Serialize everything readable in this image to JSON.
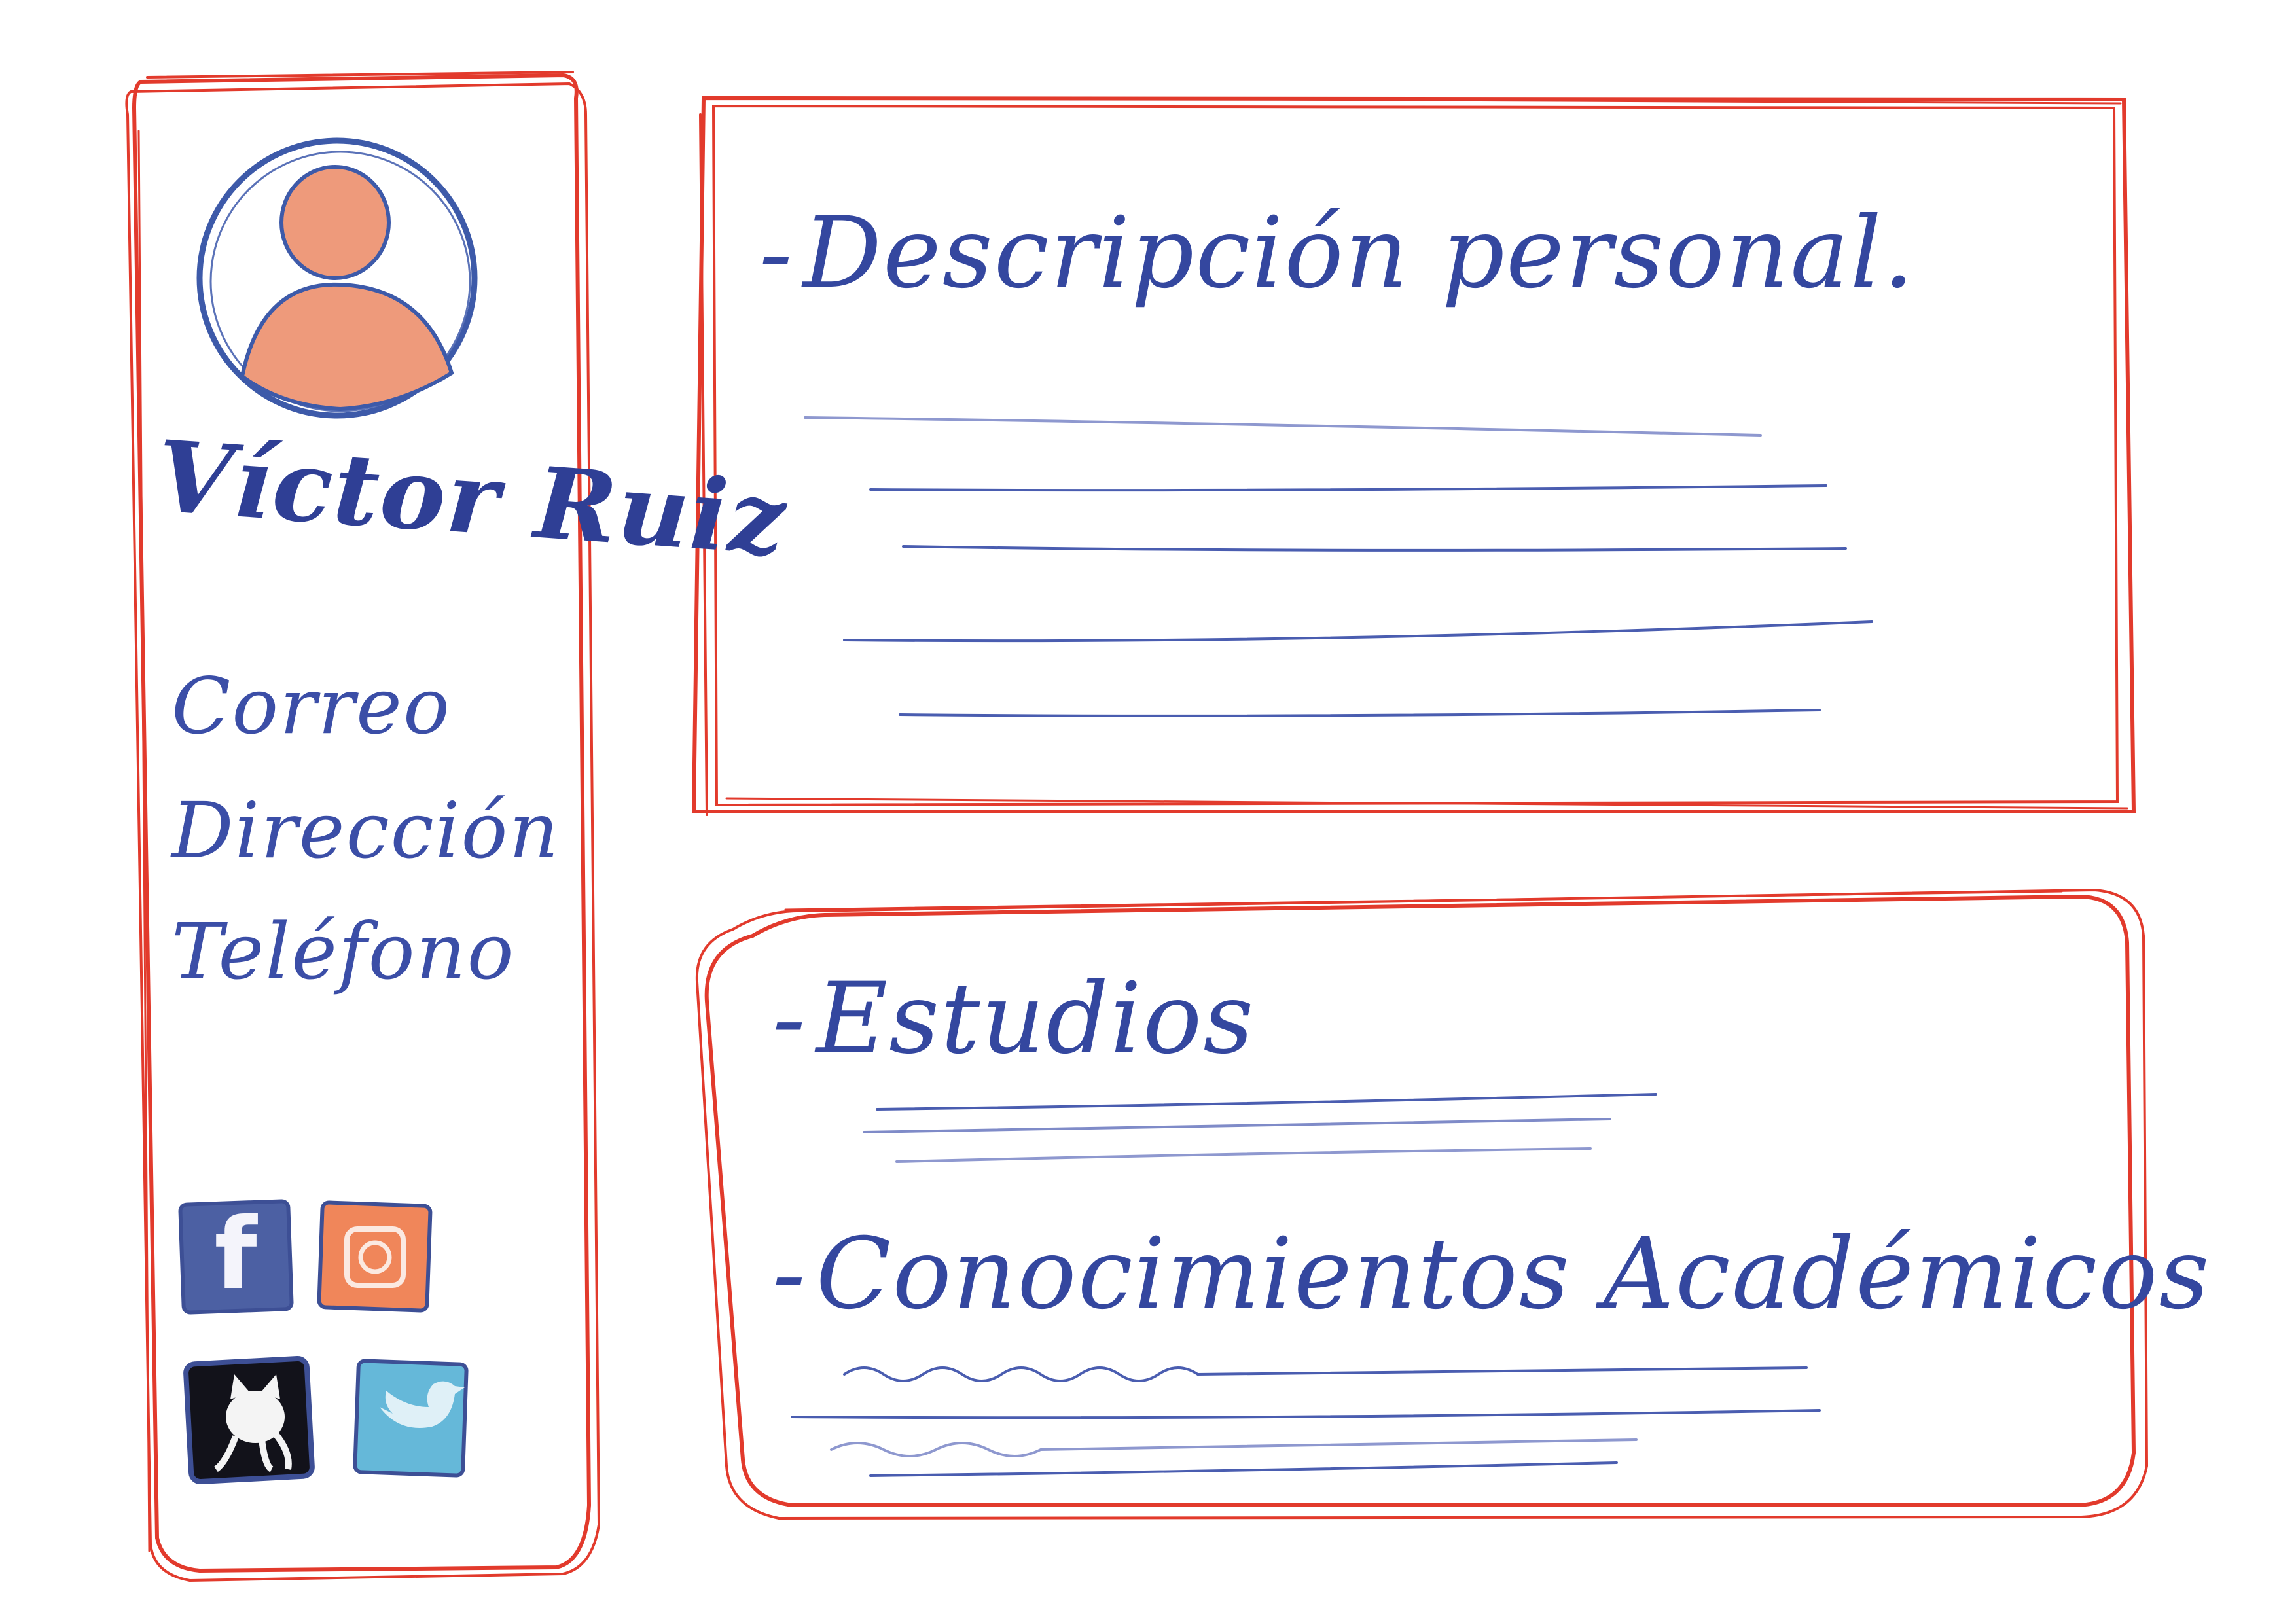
{
  "colors": {
    "frame": "#e23a2c",
    "ink": "#34479f",
    "avatar_fill": "#ee9a7b",
    "avatar_ring": "#3d5aa9"
  },
  "sidebar": {
    "name": "Víctor Ruiz",
    "contact": {
      "email_label": "Correo",
      "address_label": "Dirección",
      "phone_label": "Teléfono"
    },
    "social": [
      {
        "icon": "facebook-icon",
        "color": "#4c60a3",
        "glyph": "f"
      },
      {
        "icon": "instagram-icon",
        "color": "#f0865a",
        "glyph": "◎"
      },
      {
        "icon": "github-icon",
        "color": "#12121a",
        "glyph": "🐱"
      },
      {
        "icon": "twitter-icon",
        "color": "#65b8d9",
        "glyph": "🐦"
      }
    ]
  },
  "main": {
    "description": {
      "bullet": "-",
      "title": "Descripción personal."
    },
    "studies": {
      "bullet": "-",
      "title": "Estudios"
    },
    "knowledge": {
      "bullet": "-",
      "title": "Conocimientos Académicos"
    }
  }
}
